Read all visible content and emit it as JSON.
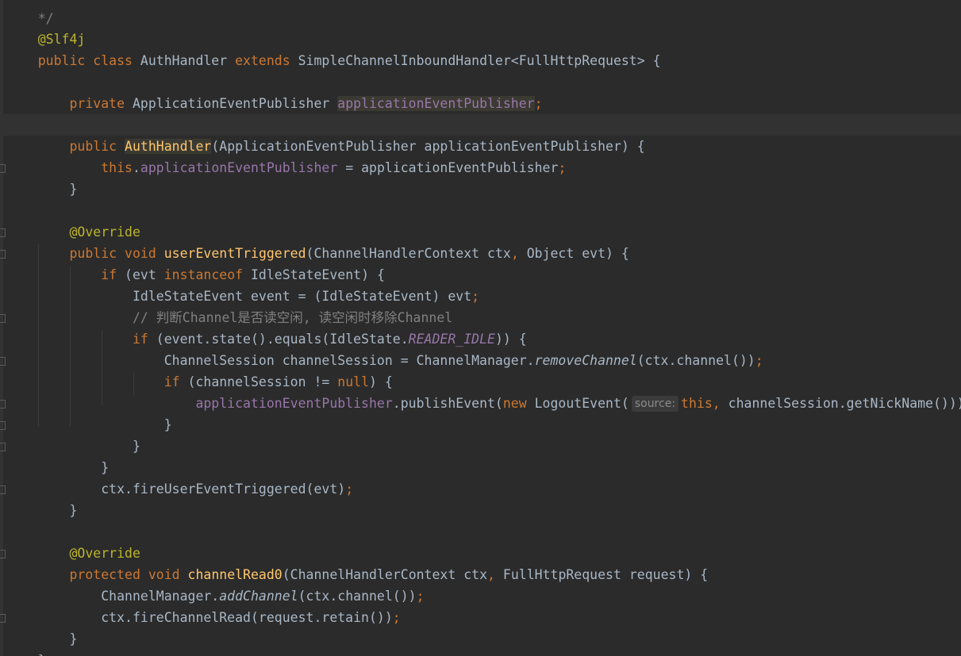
{
  "editor": {
    "lines": {
      "l0": {
        "t1": "*/"
      },
      "l1": {
        "t1": "@Slf4j"
      },
      "l2": {
        "t1": "public",
        "t2": " ",
        "t3": "class",
        "t4": " AuthHandler ",
        "t5": "extends",
        "t6": " SimpleChannelInboundHandler<FullHttpRequest> {"
      },
      "l3": {
        "t1": "private",
        "t2": " ApplicationEventPublisher ",
        "t3": "applicationEventPublisher",
        "t4": ";"
      },
      "l4": {
        "t1": "public",
        "t2": " ",
        "t3": "AuthHandler",
        "t4": "(ApplicationEventPublisher applicationEventPublisher) {"
      },
      "l5": {
        "t1": "this",
        "t2": ".",
        "t3": "applicationEventPublisher",
        "t4": " = applicationEventPublisher",
        "t5": ";"
      },
      "l6": {
        "t1": "}"
      },
      "l7": {
        "t1": "@Override"
      },
      "l8": {
        "t1": "public",
        "t2": " ",
        "t3": "void",
        "t4": " ",
        "t5": "userEventTriggered",
        "t6": "(ChannelHandlerContext ctx",
        "t7": ",",
        "t8": " Object evt) {"
      },
      "l9": {
        "t1": "if",
        "t2": " (evt ",
        "t3": "instanceof",
        "t4": " IdleStateEvent) {"
      },
      "l10": {
        "t1": "IdleStateEvent event = (IdleStateEvent) evt",
        "t2": ";"
      },
      "l11": {
        "t1": "// 判断Channel是否读空闲, 读空闲时移除Channel"
      },
      "l12": {
        "t1": "if",
        "t2": " (event.state().equals(IdleState.",
        "t3": "READER_IDLE",
        "t4": ")) {"
      },
      "l13": {
        "t1": "ChannelSession channelSession = ChannelManager.",
        "t2": "removeChannel",
        "t3": "(ctx.channel())",
        "t4": ";"
      },
      "l14": {
        "t1": "if",
        "t2": " (channelSession != ",
        "t3": "null",
        "t4": ") {"
      },
      "l15": {
        "t1": "applicationEventPublisher",
        "t2": ".publishEvent(",
        "t3": "new",
        "t4": " LogoutEvent(",
        "hint": "source:",
        "t5": "this",
        "t6": ",",
        "t7": " channelSession.getNickName()))",
        "t8": ";"
      },
      "l16": {
        "t1": "}"
      },
      "l17": {
        "t1": "}"
      },
      "l18": {
        "t1": "}"
      },
      "l19": {
        "t1": "ctx.fireUserEventTriggered(evt)",
        "t2": ";"
      },
      "l20": {
        "t1": "}"
      },
      "l21": {
        "t1": "@Override"
      },
      "l22": {
        "t1": "protected",
        "t2": " ",
        "t3": "void",
        "t4": " ",
        "t5": "channelRead0",
        "t6": "(ChannelHandlerContext ctx",
        "t7": ",",
        "t8": " FullHttpRequest request) {"
      },
      "l23": {
        "t1": "ChannelManager.",
        "t2": "addChannel",
        "t3": "(ctx.channel())",
        "t4": ";"
      },
      "l24": {
        "t1": "ctx.fireChannelRead(request.retain())",
        "t2": ";"
      },
      "l25": {
        "t1": "}"
      },
      "l26": {
        "t1": "}"
      }
    }
  }
}
